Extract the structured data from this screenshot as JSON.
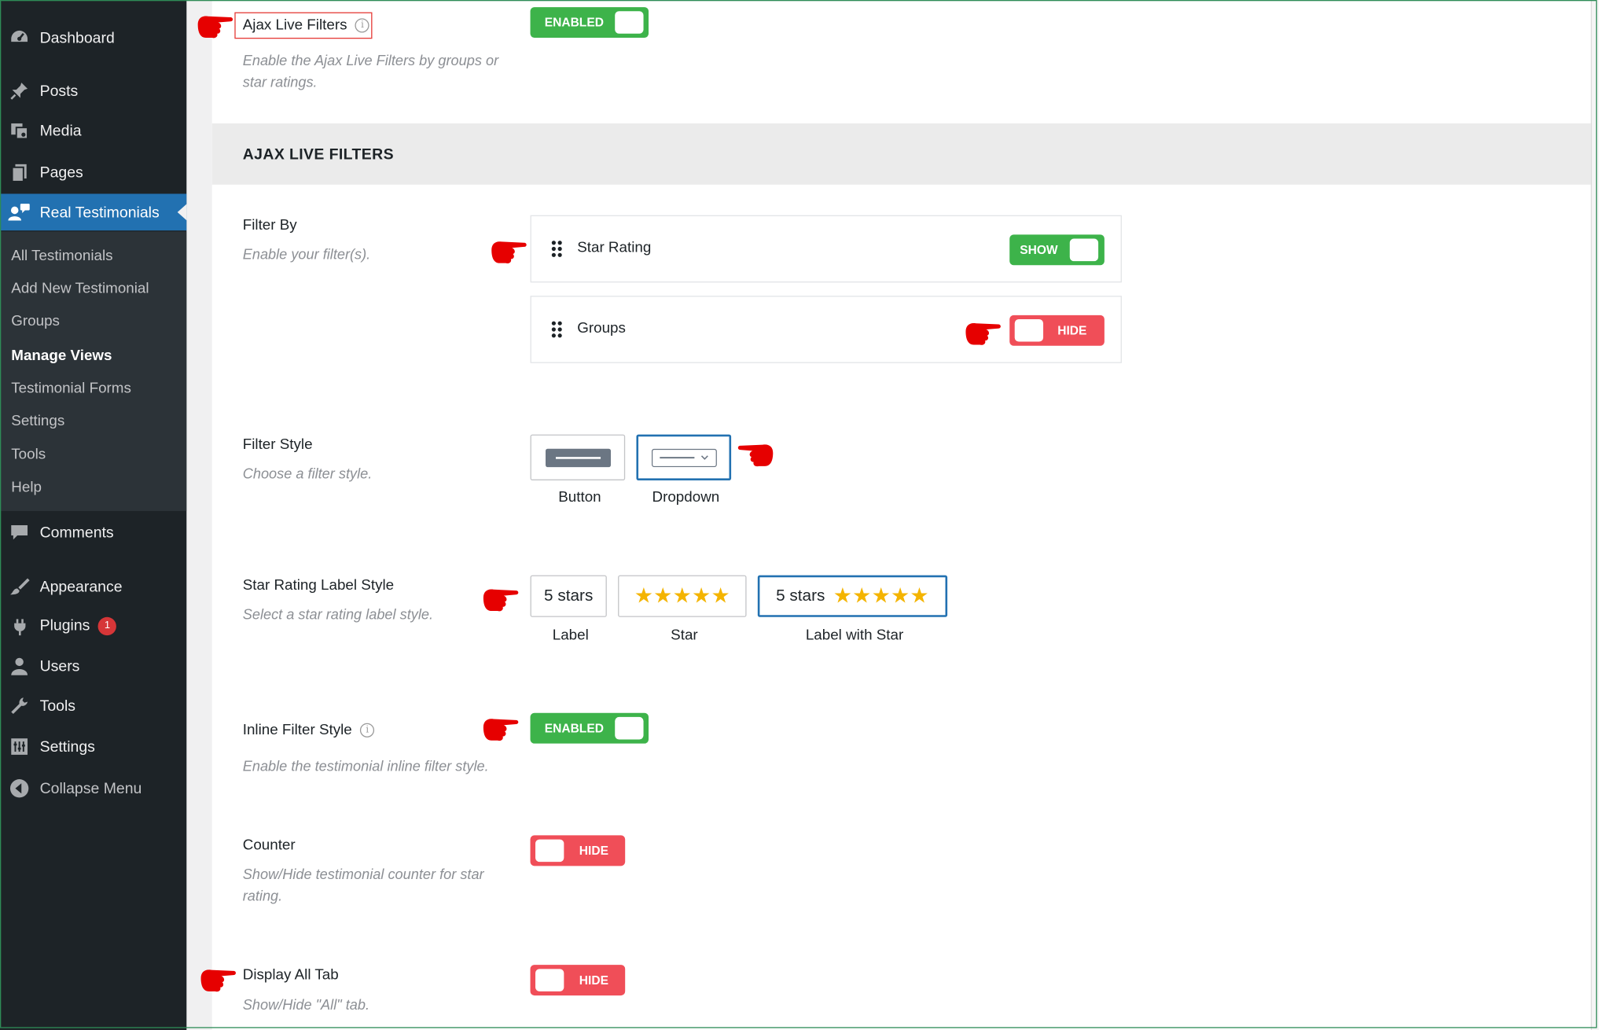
{
  "sidebar": {
    "items": {
      "dashboard": {
        "label": "Dashboard",
        "icon": "dashboard-icon"
      },
      "posts": {
        "label": "Posts",
        "icon": "pin-icon"
      },
      "media": {
        "label": "Media",
        "icon": "media-icon"
      },
      "pages": {
        "label": "Pages",
        "icon": "pages-icon"
      },
      "real_testimonials": {
        "label": "Real Testimonials",
        "icon": "testimonials-icon"
      },
      "comments": {
        "label": "Comments",
        "icon": "comments-icon"
      },
      "appearance": {
        "label": "Appearance",
        "icon": "brush-icon"
      },
      "plugins": {
        "label": "Plugins",
        "icon": "plugin-icon",
        "badge": "1"
      },
      "users": {
        "label": "Users",
        "icon": "user-icon"
      },
      "tools": {
        "label": "Tools",
        "icon": "wrench-icon"
      },
      "settings": {
        "label": "Settings",
        "icon": "settings-icon"
      },
      "collapse": {
        "label": "Collapse Menu",
        "icon": "collapse-icon"
      }
    },
    "submenu": [
      "All Testimonials",
      "Add New Testimonial",
      "Groups",
      "Manage Views",
      "Testimonial Forms",
      "Settings",
      "Tools",
      "Help"
    ]
  },
  "fields": {
    "ajax_live_filters": {
      "title": "Ajax Live Filters",
      "desc_line1": "Enable the Ajax Live Filters by groups or",
      "desc_line2": "star ratings.",
      "toggle": "ENABLED"
    },
    "section_title": "AJAX LIVE FILTERS",
    "filter_by": {
      "title": "Filter By",
      "desc": "Enable your filter(s).",
      "rows": [
        {
          "label": "Star Rating",
          "toggle": "SHOW"
        },
        {
          "label": "Groups",
          "toggle": "HIDE"
        }
      ]
    },
    "filter_style": {
      "title": "Filter Style",
      "desc": "Choose a filter style.",
      "options": [
        "Button",
        "Dropdown"
      ],
      "selected": "Dropdown"
    },
    "star_label_style": {
      "title": "Star Rating Label Style",
      "desc": "Select a star rating label style.",
      "box_label_text": "5 stars",
      "stars": "★★★★★",
      "options": [
        "Label",
        "Star",
        "Label with Star"
      ],
      "selected": "Label with Star"
    },
    "inline_filter": {
      "title": "Inline Filter Style",
      "desc": "Enable the testimonial inline filter style.",
      "toggle": "ENABLED"
    },
    "counter": {
      "title": "Counter",
      "desc_line1": "Show/Hide testimonial counter for star",
      "desc_line2": "rating.",
      "toggle": "HIDE"
    },
    "display_all_tab": {
      "title": "Display All Tab",
      "desc": "Show/Hide \"All\" tab.",
      "toggle": "HIDE"
    }
  },
  "colors": {
    "enabled": "#3db34a",
    "disabled": "#f04e58",
    "accent": "#2271b1",
    "sidebar": "#1d2327",
    "annotation": "#e60000"
  }
}
